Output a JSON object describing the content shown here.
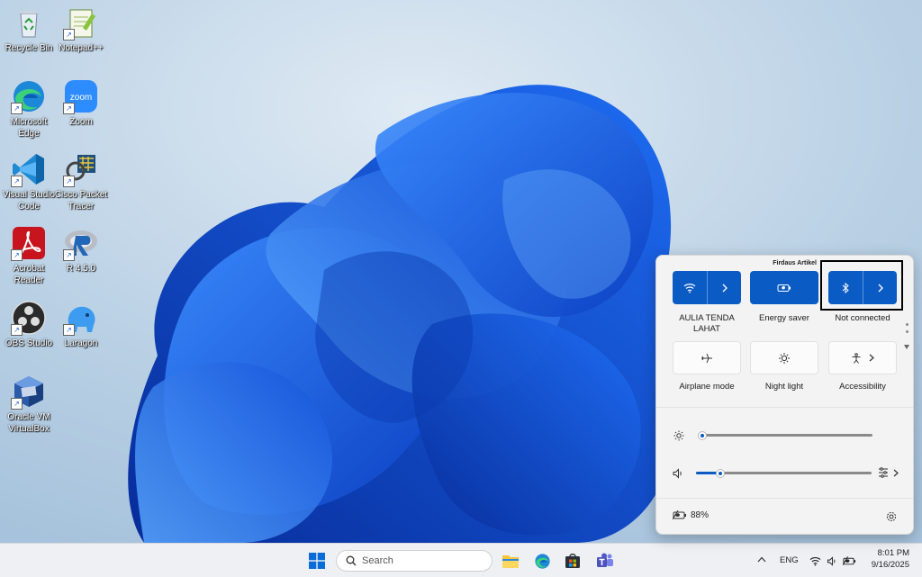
{
  "desktop": {
    "icons": [
      {
        "label": "Recycle Bin",
        "icon": "recycle-bin-icon"
      },
      {
        "label": "Notepad++",
        "icon": "notepad-plus-plus-icon"
      },
      {
        "label": "Microsoft Edge",
        "icon": "edge-icon"
      },
      {
        "label": "Zoom",
        "icon": "zoom-icon",
        "badge": "zoom"
      },
      {
        "label": "Visual Studio Code",
        "icon": "vscode-icon"
      },
      {
        "label": "Cisco Packet Tracer",
        "icon": "packet-tracer-icon"
      },
      {
        "label": "Acrobat Reader",
        "icon": "acrobat-icon"
      },
      {
        "label": "R 4.5.0",
        "icon": "r-icon"
      },
      {
        "label": "OBS Studio",
        "icon": "obs-icon"
      },
      {
        "label": "Laragon",
        "icon": "laragon-icon"
      },
      {
        "label": "Oracle VM VirtualBox",
        "icon": "virtualbox-icon"
      }
    ]
  },
  "quick_settings": {
    "user": "Firdaus Artikel",
    "tiles": [
      {
        "label": "AULIA TENDA LAHAT",
        "icon": "wifi-icon",
        "state": "on",
        "has_arrow": true
      },
      {
        "label": "Energy saver",
        "icon": "battery-saver-icon",
        "state": "on",
        "has_arrow": false
      },
      {
        "label": "Not connected",
        "icon": "bluetooth-icon",
        "state": "on",
        "has_arrow": true
      },
      {
        "label": "Airplane mode",
        "icon": "airplane-icon",
        "state": "off",
        "has_arrow": false
      },
      {
        "label": "Night light",
        "icon": "night-light-icon",
        "state": "off",
        "has_arrow": false
      },
      {
        "label": "Accessibility",
        "icon": "accessibility-icon",
        "state": "off",
        "has_arrow": true
      }
    ],
    "brightness": {
      "icon": "brightness-icon",
      "level": 0
    },
    "volume": {
      "icon": "volume-icon",
      "level": 0.1
    },
    "battery": {
      "icon": "battery-icon",
      "text": "88%"
    },
    "settings_icon": "settings-icon"
  },
  "taskbar": {
    "search_placeholder": "Search",
    "apps": [
      "start-icon",
      "search-icon",
      "file-explorer-icon",
      "edge-icon",
      "microsoft-store-icon",
      "teams-icon"
    ],
    "tray": {
      "language": "ENG",
      "time": "8:01 PM",
      "date": "9/16/2025"
    }
  },
  "colors": {
    "accent": "#0a5bc4",
    "panel_bg": "#f3f3f3",
    "taskbar_bg": "#eef0f4"
  }
}
